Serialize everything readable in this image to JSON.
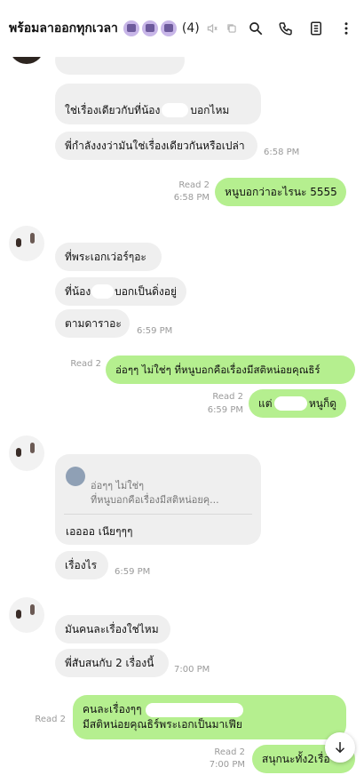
{
  "header": {
    "title": "พร้อมลาออกทุกเวลา",
    "member_count": "(4)",
    "emoji_icons": [
      "person-emoji",
      "person-emoji",
      "person-emoji"
    ],
    "actions": [
      "search-icon",
      "call-icon",
      "notes-icon",
      "more-icon"
    ]
  },
  "messages": {
    "m1": "ใช่เรื่องเดียวกับที่น้อง",
    "m1b": "บอกไหม",
    "m2": "พี่กำลังงงว่ามันใช่เรื่องเดียวกันหรือเปล่า",
    "m2_time": "6:58 PM",
    "o1": "หนูบอกว่าอะไรนะ 5555",
    "o1_read": "Read 2",
    "o1_time": "6:58 PM",
    "m3": "ที่พระเอกเว่อร์ๆอะ",
    "m4a": "ที่น้อง",
    "m4b": "บอกเป็นดิ่งอยู่",
    "m5": "ตามดาราอะ",
    "m5_time": "6:59 PM",
    "o2": "อ่อๆๆ ไม่ใช่ๆ ที่หนูบอกคือเรื่องมีสติหน่อยคุณธิร์",
    "o2_read": "Read 2",
    "o3a": "แต่",
    "o3b": "หนูก็ดู",
    "o3_read": "Read 2",
    "o3_time": "6:59 PM",
    "reply_quote_line1": "อ่อๆๆ ไม่ใช่ๆ",
    "reply_quote_line2": "ที่หนูบอกคือเรื่องมีสติหน่อยคุ...",
    "reply_text": "เออออ เนียๆๆๆ",
    "m6": "เรื่องไร",
    "m6_time": "6:59 PM",
    "m7": "มันคนละเรื่องใช่ไหม",
    "m8": "พี่สับสนกับ 2 เรื่องนี้",
    "m8_time": "7:00 PM",
    "o4_line1": "คนละเรื่องๆๆ",
    "o4_line2": "มีสติหน่อยคุณธิร์พระเอกเป็นมาเฟีย",
    "o4_read": "Read 2",
    "o5": "สนุกนะทั้ง2เรื่อ",
    "o5_read": "Read 2",
    "o5_time": "7:00 PM"
  },
  "colors": {
    "incoming_bubble": "#efefef",
    "outgoing_bubble": "#b5ef8f"
  }
}
